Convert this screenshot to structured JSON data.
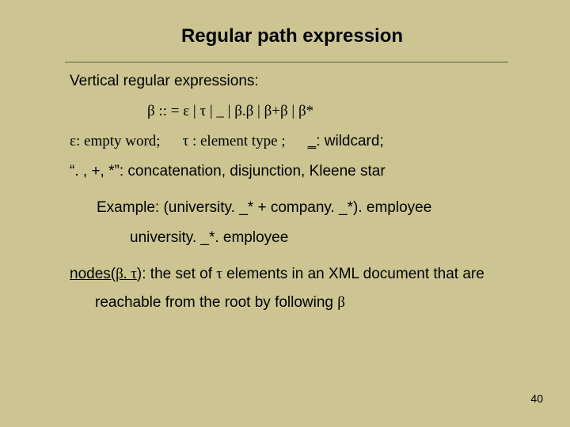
{
  "title": "Regular path expression",
  "intro": "Vertical regular expressions:",
  "grammar": "β  :: =  ε   |  τ  |  _   |  β.β   |   β+β   |  β*",
  "defs": {
    "eps": "ε: empty word;",
    "tau": "τ :  element type ;",
    "wild_us": "_",
    "wild_rest": ": wildcard;"
  },
  "ops": "“. , +, *”:  concatenation, disjunction, Kleene star",
  "example_label": "Example: (university. _* +  company. _*). employee",
  "example_sub": "university. _*. employee",
  "nodes": {
    "pre": "nodes(",
    "args": "β. τ",
    "mid1": "): the set of ",
    "tau": "τ",
    "mid2": " elements in an XML document that are",
    "line2a": "reachable from the root by following ",
    "beta": "β"
  },
  "page": "40"
}
